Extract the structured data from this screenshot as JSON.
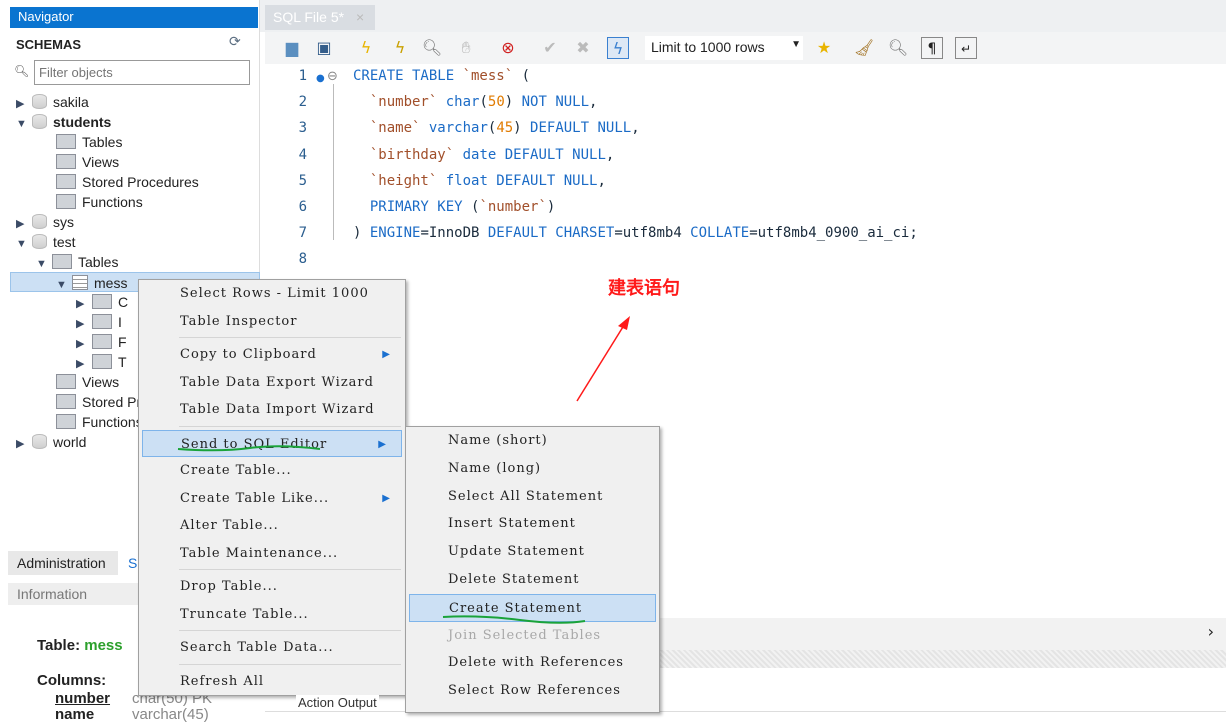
{
  "navigator": {
    "title": "Navigator",
    "schemas_label": "SCHEMAS",
    "filter_placeholder": "Filter objects",
    "tree": [
      {
        "label": "sakila",
        "level": 0,
        "expanded": false,
        "type": "db"
      },
      {
        "label": "students",
        "level": 0,
        "expanded": true,
        "type": "db",
        "bold": true
      },
      {
        "label": "Tables",
        "level": 1,
        "type": "folder"
      },
      {
        "label": "Views",
        "level": 1,
        "type": "folder"
      },
      {
        "label": "Stored Procedures",
        "level": 1,
        "type": "folder"
      },
      {
        "label": "Functions",
        "level": 1,
        "type": "folder"
      },
      {
        "label": "sys",
        "level": 0,
        "expanded": false,
        "type": "db"
      },
      {
        "label": "test",
        "level": 0,
        "expanded": true,
        "type": "db"
      },
      {
        "label": "Tables",
        "level": 1,
        "expanded": true,
        "type": "folder"
      },
      {
        "label": "mess",
        "level": 2,
        "expanded": true,
        "type": "table",
        "selected": true
      },
      {
        "label": "C",
        "level": 3,
        "expanded": false,
        "type": "folder"
      },
      {
        "label": "I",
        "level": 3,
        "expanded": false,
        "type": "folder"
      },
      {
        "label": "F",
        "level": 3,
        "expanded": false,
        "type": "folder"
      },
      {
        "label": "T",
        "level": 3,
        "expanded": false,
        "type": "folder"
      },
      {
        "label": "Views",
        "level": 1,
        "type": "folder"
      },
      {
        "label": "Stored Pr",
        "level": 1,
        "type": "folder"
      },
      {
        "label": "Functions",
        "level": 1,
        "type": "folder"
      },
      {
        "label": "world",
        "level": 0,
        "expanded": false,
        "type": "db"
      }
    ]
  },
  "bottom_tabs": {
    "administration": "Administration",
    "schemas": "S"
  },
  "information": {
    "title": "Information",
    "table_label": "Table:",
    "table_name": "mess",
    "columns_label": "Columns:",
    "columns": [
      {
        "name": "number",
        "type": "char(50) PK"
      },
      {
        "name": "name",
        "type": "varchar(45)"
      }
    ]
  },
  "editor_tab": {
    "label": "SQL File 5*",
    "close": "×"
  },
  "toolbar": {
    "limit_select": "Limit to 1000 rows",
    "icons": [
      "open-folder-icon",
      "save-icon",
      "execute-icon",
      "execute-current-icon",
      "explain-icon",
      "stop-icon",
      "toggle-error-icon",
      "commit-icon",
      "rollback-icon",
      "autocommit-icon",
      "add-snippet-icon",
      "beautify-icon",
      "find-icon",
      "invisible-chars-icon",
      "wrap-icon"
    ]
  },
  "code": [
    [
      [
        "kw",
        "CREATE TABLE "
      ],
      [
        "id",
        "`mess`"
      ],
      [
        "pl",
        " ("
      ]
    ],
    [
      [
        "pl",
        "  "
      ],
      [
        "id",
        "`number`"
      ],
      [
        "kw",
        " char"
      ],
      [
        "pl",
        "("
      ],
      [
        "num",
        "50"
      ],
      [
        "pl",
        ") "
      ],
      [
        "kw",
        "NOT NULL"
      ],
      [
        "pl",
        ","
      ]
    ],
    [
      [
        "pl",
        "  "
      ],
      [
        "id",
        "`name`"
      ],
      [
        "kw",
        " varchar"
      ],
      [
        "pl",
        "("
      ],
      [
        "num",
        "45"
      ],
      [
        "pl",
        ") "
      ],
      [
        "kw",
        "DEFAULT NULL"
      ],
      [
        "pl",
        ","
      ]
    ],
    [
      [
        "pl",
        "  "
      ],
      [
        "id",
        "`birthday`"
      ],
      [
        "kw",
        " date DEFAULT NULL"
      ],
      [
        "pl",
        ","
      ]
    ],
    [
      [
        "pl",
        "  "
      ],
      [
        "id",
        "`height`"
      ],
      [
        "kw",
        " float DEFAULT NULL"
      ],
      [
        "pl",
        ","
      ]
    ],
    [
      [
        "pl",
        "  "
      ],
      [
        "kw",
        "PRIMARY KEY"
      ],
      [
        "pl",
        " ("
      ],
      [
        "id",
        "`number`"
      ],
      [
        "pl",
        ")"
      ]
    ],
    [
      [
        "pl",
        ") "
      ],
      [
        "kw",
        "ENGINE"
      ],
      [
        "pl",
        "=InnoDB "
      ],
      [
        "kw",
        "DEFAULT CHARSET"
      ],
      [
        "pl",
        "=utf8mb4 "
      ],
      [
        "kw",
        "COLLATE"
      ],
      [
        "pl",
        "=utf8mb4_0900_ai_ci;"
      ]
    ],
    []
  ],
  "context_menu": [
    {
      "label": "Select Rows - Limit 1000"
    },
    {
      "label": "Table Inspector"
    },
    {
      "sep": true
    },
    {
      "label": "Copy to Clipboard",
      "submenu": true
    },
    {
      "label": "Table Data Export Wizard"
    },
    {
      "label": "Table Data Import Wizard"
    },
    {
      "sep": true
    },
    {
      "label": "Send to SQL Editor",
      "submenu": true,
      "highlighted": true
    },
    {
      "label": "Create Table..."
    },
    {
      "label": "Create Table Like...",
      "submenu": true
    },
    {
      "label": "Alter Table..."
    },
    {
      "label": "Table Maintenance..."
    },
    {
      "sep": true
    },
    {
      "label": "Drop Table..."
    },
    {
      "label": "Truncate Table..."
    },
    {
      "sep": true
    },
    {
      "label": "Search Table Data..."
    },
    {
      "sep": true
    },
    {
      "label": "Refresh All"
    }
  ],
  "submenu": [
    {
      "label": "Name (short)"
    },
    {
      "label": "Name (long)"
    },
    {
      "label": "Select All Statement"
    },
    {
      "label": "Insert Statement"
    },
    {
      "label": "Update Statement"
    },
    {
      "label": "Delete Statement"
    },
    {
      "label": "Create Statement",
      "highlighted": true
    },
    {
      "label": "Join Selected Tables",
      "disabled": true
    },
    {
      "label": "Delete with References"
    },
    {
      "label": "Select Row References"
    }
  ],
  "output": {
    "action_output": "Action Output",
    "scroll_right": "›"
  },
  "annotation": {
    "text": "建表语句",
    "color": "#ff1a1a",
    "underline_color": "#1aa33a"
  }
}
